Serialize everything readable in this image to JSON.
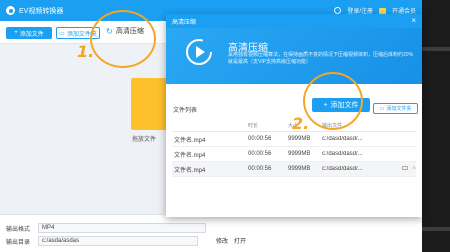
{
  "app": {
    "title": "EV视频转换器",
    "login": "登录/注册",
    "vip": "开通会员"
  },
  "toolbar": {
    "add_file": "添加文件",
    "add_folder": "添加文件夹",
    "hd_compress": "高清压缩"
  },
  "main": {
    "drop_hint": "拖放文件"
  },
  "bottom": {
    "format_label": "输出格式",
    "format_value": "MP4",
    "dir_label": "输出目录",
    "dir_value": "c:/asda/asdas",
    "modify": "修改",
    "open": "打开"
  },
  "dialog": {
    "title": "高清压缩",
    "close": "×",
    "heading": "高清压缩",
    "description": "采用独有视频压缩算法，在保持画质不变的情况下压缩视频体积，压缩后体积约20%就是最高（支VIP支持高级压缩功能）",
    "list_title": "文件列表",
    "add_file": "添加文件",
    "add_folder": "添加文件夹",
    "columns": {
      "name": "",
      "duration": "时长",
      "size": "大小",
      "path": "输出文件"
    },
    "rows": [
      {
        "name": "文件名.mp4",
        "duration": "00:00:56",
        "size": "9999MB",
        "path": "c:/dasd/dasd/..."
      },
      {
        "name": "文件名.mp4",
        "duration": "00:00:56",
        "size": "9999MB",
        "path": "c:/dasd/dasd/..."
      },
      {
        "name": "文件名.mp4",
        "duration": "00:00:56",
        "size": "9999MB",
        "path": "c:/dasd/dasd/..."
      }
    ]
  },
  "annotations": {
    "step1": "1.",
    "step2": "2."
  },
  "colors": {
    "brand": "#1a9ff2",
    "annotation": "#f5a623",
    "folder_yellow": "#ffc12b"
  }
}
